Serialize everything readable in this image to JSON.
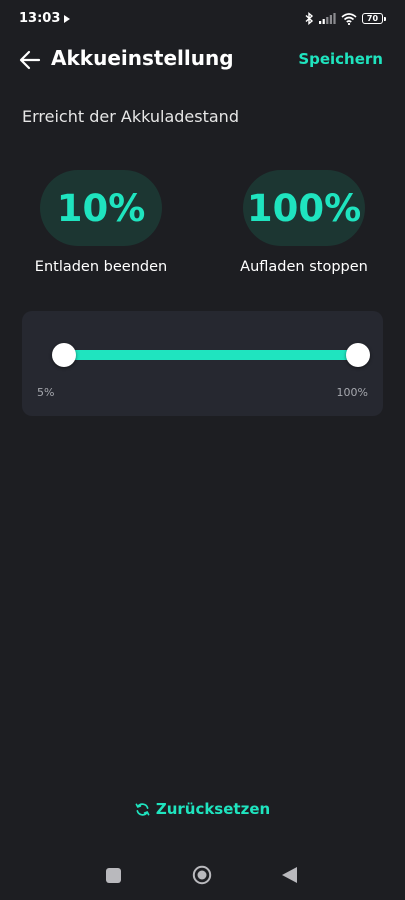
{
  "status_bar": {
    "time": "13:03",
    "battery_level": "70",
    "icons": [
      "play-icon",
      "bluetooth-icon",
      "signal-icon",
      "wifi-icon",
      "battery-icon"
    ]
  },
  "header": {
    "title": "Akkueinstellung",
    "save_label": "Speichern"
  },
  "section": {
    "label": "Erreicht der Akkuladestand"
  },
  "discharge": {
    "value": "10%",
    "caption": "Entladen beenden"
  },
  "charge": {
    "value": "100%",
    "caption": "Aufladen stoppen"
  },
  "slider": {
    "min_label": "5%",
    "max_label": "100%",
    "lower_value_percent": 10,
    "upper_value_percent": 100
  },
  "reset": {
    "label": "Zurücksetzen"
  },
  "colors": {
    "accent": "#1fe4bf",
    "background": "#1d1e22",
    "card": "#262830",
    "pill": "#1c3632"
  }
}
